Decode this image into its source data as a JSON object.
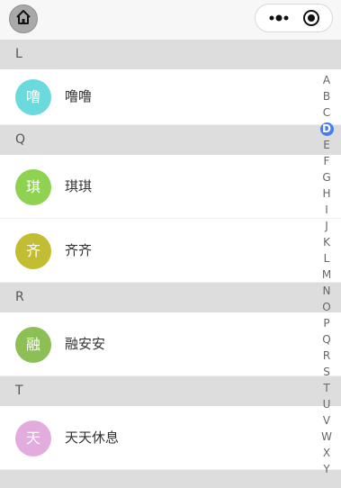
{
  "colors": {
    "accent": "#4a7bf0",
    "header_bg": "#dddddd",
    "avatar_l": "#6bdadd",
    "avatar_qi1": "#8fd151",
    "avatar_qi2": "#c2bd33",
    "avatar_r": "#8cc057",
    "avatar_t": "#e3acdf"
  },
  "icons": {
    "home": "home-icon",
    "more": "more-dots-icon",
    "target": "target-icon"
  },
  "sections": [
    {
      "letter": "L",
      "contacts": [
        {
          "avatar": "噜",
          "name": "噜噜"
        }
      ]
    },
    {
      "letter": "Q",
      "contacts": [
        {
          "avatar": "琪",
          "name": "琪琪"
        },
        {
          "avatar": "齐",
          "name": "齐齐"
        }
      ]
    },
    {
      "letter": "R",
      "contacts": [
        {
          "avatar": "融",
          "name": "融安安"
        }
      ]
    },
    {
      "letter": "T",
      "contacts": [
        {
          "avatar": "天",
          "name": "天天休息"
        }
      ]
    }
  ],
  "index": {
    "letters": [
      "A",
      "B",
      "C",
      "D",
      "E",
      "F",
      "G",
      "H",
      "I",
      "J",
      "K",
      "L",
      "M",
      "N",
      "O",
      "P",
      "Q",
      "R",
      "S",
      "T",
      "U",
      "V",
      "W",
      "X",
      "Y"
    ],
    "active": "D"
  }
}
